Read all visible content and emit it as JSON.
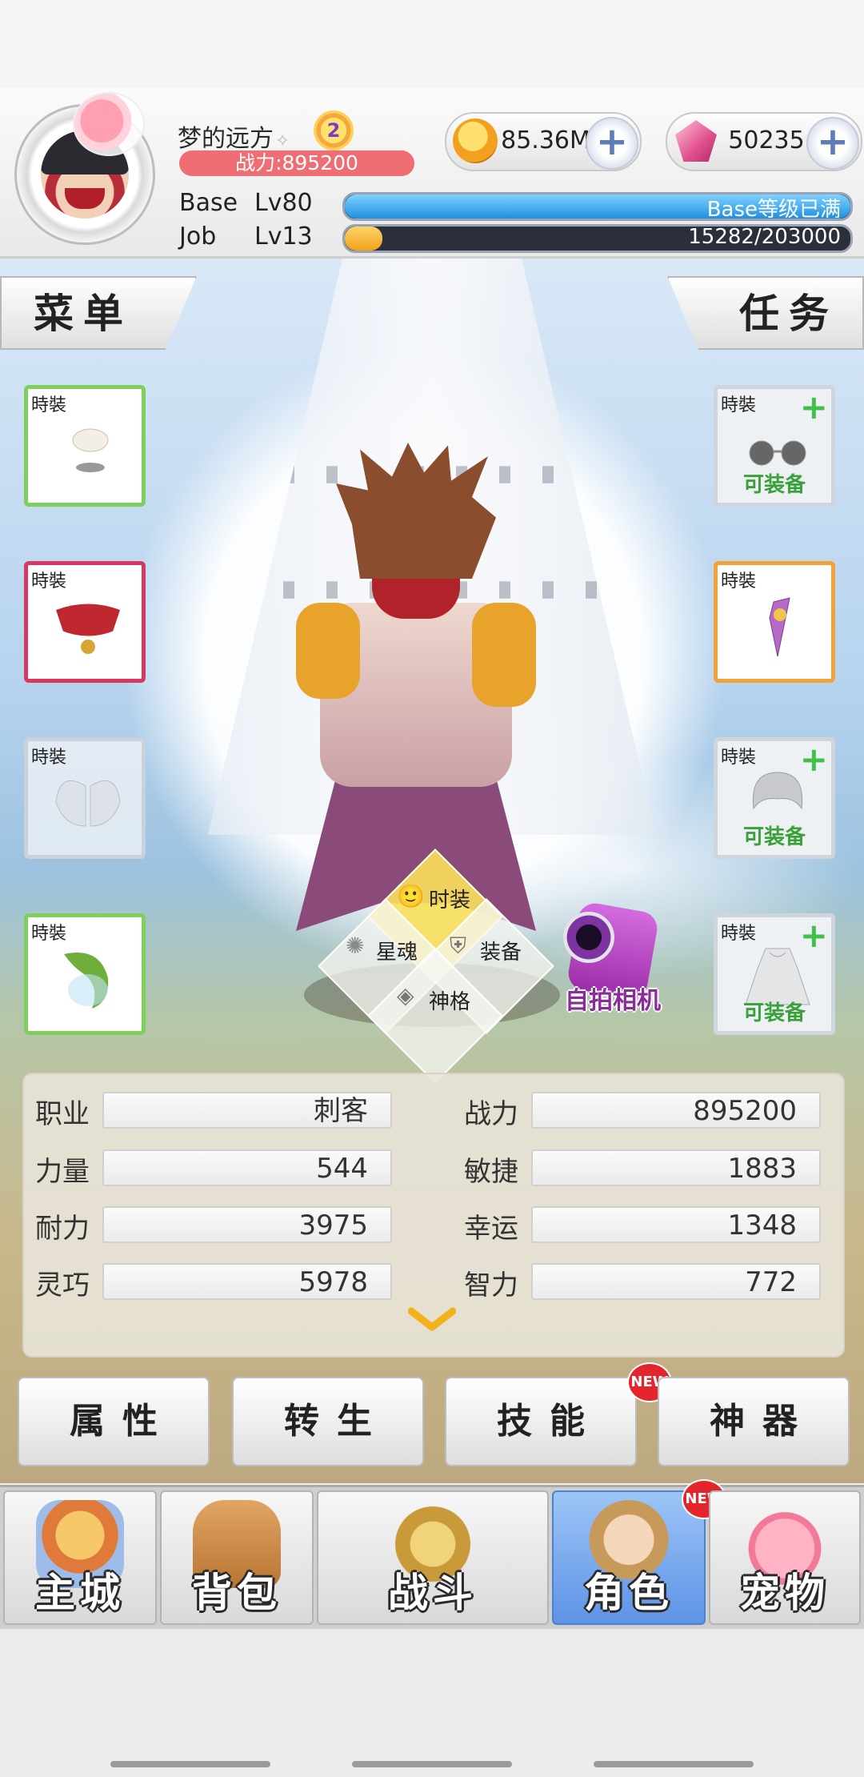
{
  "player": {
    "name": "梦的远方",
    "vip_level": "2",
    "power_text": "战力:895200"
  },
  "currency": {
    "gold": "85.36M",
    "gems": "50235"
  },
  "levels": {
    "base_label": "Base",
    "base_lv": "Lv80",
    "base_text": "Base等级已满",
    "base_progress": 1.0,
    "job_label": "Job",
    "job_lv": "Lv13",
    "job_text": "15282/203000",
    "job_progress": 0.075
  },
  "menu": {
    "left": "菜单",
    "right": "任务"
  },
  "slots": {
    "tag": "時裝",
    "equip_label": "可装备"
  },
  "ring_menu": {
    "fashion": "时装",
    "star_soul": "星魂",
    "equipment": "装备",
    "divinity": "神格"
  },
  "camera_label": "自拍相机",
  "stats": {
    "job_label": "职业",
    "job_value": "刺客",
    "power_label": "战力",
    "power_value": "895200",
    "str_label": "力量",
    "str_value": "544",
    "agi_label": "敏捷",
    "agi_value": "1883",
    "vit_label": "耐力",
    "vit_value": "3975",
    "luk_label": "幸运",
    "luk_value": "1348",
    "dex_label": "灵巧",
    "dex_value": "5978",
    "int_label": "智力",
    "int_value": "772"
  },
  "func_buttons": {
    "attributes": "属性",
    "rebirth": "转生",
    "skills": "技能",
    "artifact": "神器",
    "new_badge": "NEW"
  },
  "nav": {
    "city": "主城",
    "bag": "背包",
    "battle": "战斗",
    "character": "角色",
    "pet": "宠物",
    "new_badge": "NEW"
  },
  "colors": {
    "accent_blue": "#5d93e6",
    "power_red": "#ef6e74",
    "equip_green": "#3aa13a"
  }
}
